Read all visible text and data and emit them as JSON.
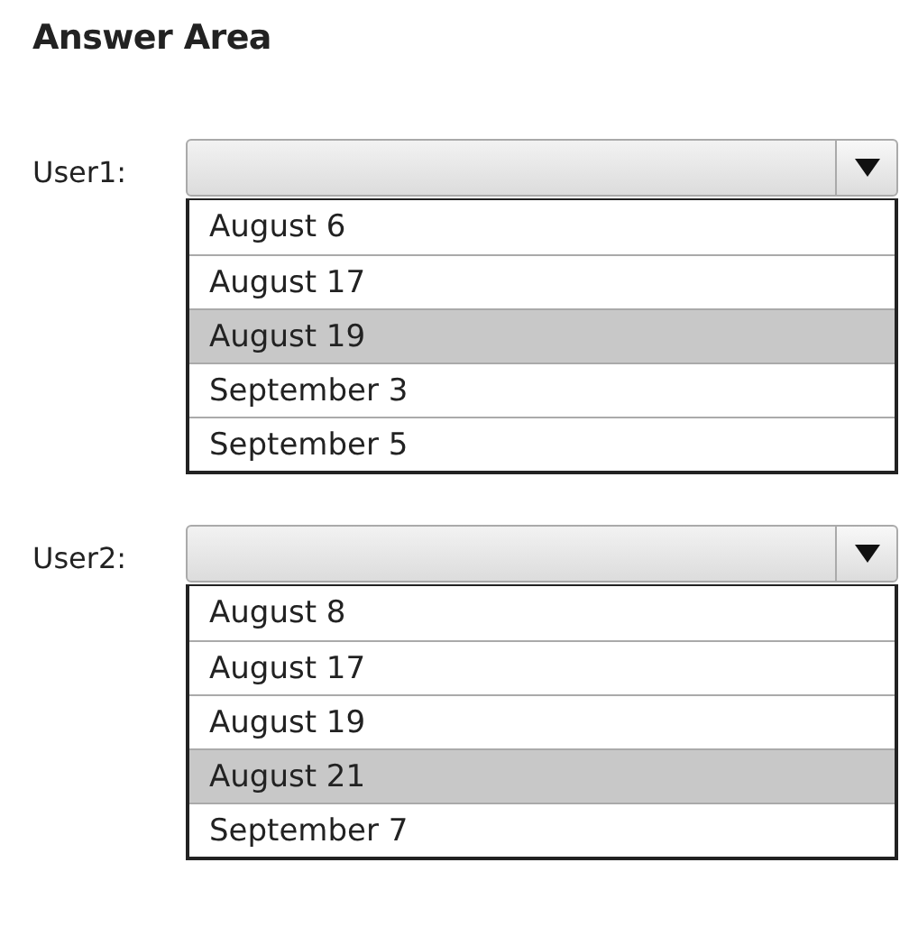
{
  "title": "Answer Area",
  "questions": [
    {
      "label": "User1:",
      "options": [
        {
          "text": "August 6",
          "selected": false
        },
        {
          "text": "August 17",
          "selected": false
        },
        {
          "text": "August 19",
          "selected": true
        },
        {
          "text": "September 3",
          "selected": false
        },
        {
          "text": "September 5",
          "selected": false
        }
      ]
    },
    {
      "label": "User2:",
      "options": [
        {
          "text": "August 8",
          "selected": false
        },
        {
          "text": "August 17",
          "selected": false
        },
        {
          "text": "August 19",
          "selected": false
        },
        {
          "text": "August 21",
          "selected": true
        },
        {
          "text": "September 7",
          "selected": false
        }
      ]
    }
  ]
}
